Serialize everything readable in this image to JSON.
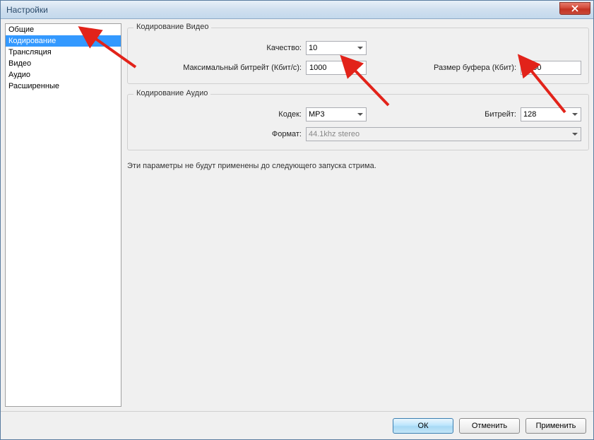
{
  "window": {
    "title": "Настройки"
  },
  "sidebar": {
    "items": [
      {
        "label": "Общие"
      },
      {
        "label": "Кодирование",
        "selected": true
      },
      {
        "label": "Трансляция"
      },
      {
        "label": "Видео"
      },
      {
        "label": "Аудио"
      },
      {
        "label": "Расширенные"
      }
    ]
  },
  "video_group": {
    "title": "Кодирование Видео",
    "quality_label": "Качество:",
    "quality_value": "10",
    "maxbitrate_label": "Максимальный битрейт (Кбит/с):",
    "maxbitrate_value": "1000",
    "buffer_label": "Размер буфера (Кбит):",
    "buffer_value": "1000"
  },
  "audio_group": {
    "title": "Кодирование Аудио",
    "codec_label": "Кодек:",
    "codec_value": "MP3",
    "bitrate_label": "Битрейт:",
    "bitrate_value": "128",
    "format_label": "Формат:",
    "format_value": "44.1khz stereo"
  },
  "note": "Эти параметры не будут применены до следующего запуска стрима.",
  "footer": {
    "ok": "ОК",
    "cancel": "Отменить",
    "apply": "Применить"
  }
}
